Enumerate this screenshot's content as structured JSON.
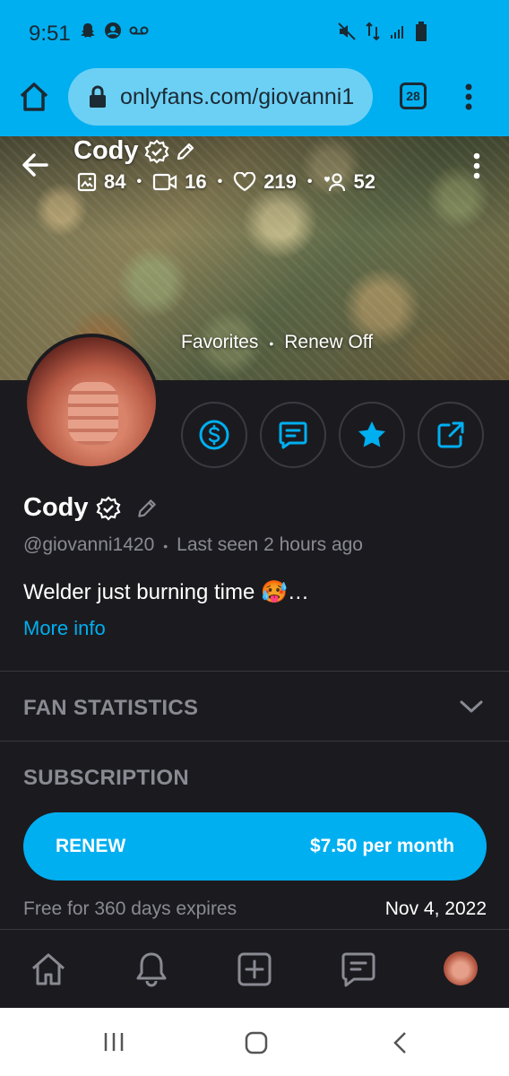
{
  "status_bar": {
    "time": "9:51",
    "icons_left": [
      "snapchat-icon",
      "account-circle-icon",
      "voicemail-icon"
    ],
    "icons_right": [
      "mute-icon",
      "data-icon",
      "signal-icon",
      "battery-icon"
    ]
  },
  "browser": {
    "url": "onlyfans.com/giovanni1",
    "tab_count": "28"
  },
  "cover": {
    "name": "Cody",
    "stats": [
      {
        "icon": "image-icon",
        "value": "84"
      },
      {
        "icon": "video-icon",
        "value": "16"
      },
      {
        "icon": "heart-icon",
        "value": "219"
      },
      {
        "icon": "fans-icon",
        "value": "52"
      }
    ],
    "link_favorites": "Favorites",
    "link_renew": "Renew Off"
  },
  "profile": {
    "name": "Cody",
    "handle": "@giovanni1420",
    "last_seen": "Last seen 2 hours ago",
    "bio": "Welder just burning time 🥵…",
    "more_info": "More info"
  },
  "sections": {
    "fan_statistics": "FAN STATISTICS",
    "subscription": "SUBSCRIPTION"
  },
  "subscription": {
    "renew_label": "RENEW",
    "price": "$7.50 per month",
    "free_text": "Free for 360 days expires",
    "expiry_date": "Nov 4, 2022"
  },
  "colors": {
    "accent": "#00aff0",
    "background": "#1b1b1f",
    "muted_text": "#8a8a93"
  }
}
